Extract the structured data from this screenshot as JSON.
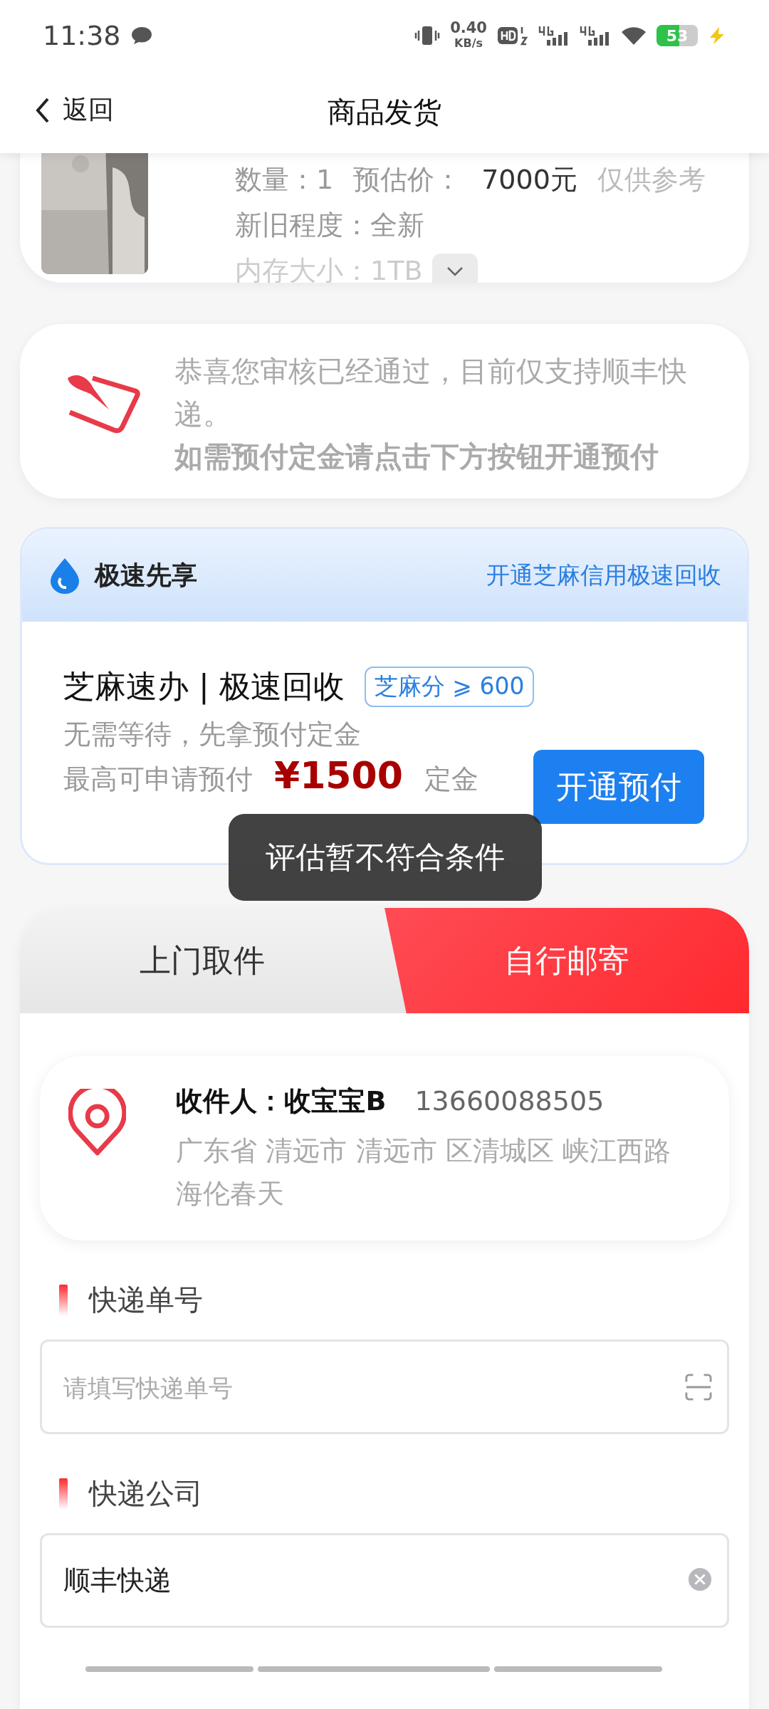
{
  "status_bar": {
    "time": "11:38",
    "speed": "0.40",
    "speed_unit": "KB/s",
    "battery": "53"
  },
  "header": {
    "back": "返回",
    "title": "商品发货"
  },
  "product": {
    "quantity": "数量：1",
    "price_label": "预估价：",
    "price": "7000元",
    "price_note": "仅供参考",
    "condition": "新旧程度：全新",
    "storage": "内存大小：1TB"
  },
  "notice": {
    "text": "恭喜您审核已经通过，目前仅支持顺丰快递。",
    "bold_text": "如需预付定金请点击下方按钮开通预付"
  },
  "prepay": {
    "title": "极速先享",
    "link": "开通芝麻信用极速回收",
    "heading": "芝麻速办 | 极速回收",
    "badge": "芝麻分 ⩾ 600",
    "subtitle": "无需等待，先拿预付定金",
    "limit_prefix": "最高可申请预付",
    "amount": "¥1500",
    "limit_suffix": "定金",
    "button": "开通预付"
  },
  "toast": "评估暂不符合条件",
  "tabs": [
    {
      "label": "上门取件",
      "selected": false
    },
    {
      "label": "自行邮寄",
      "selected": true
    }
  ],
  "address": {
    "recipient": "收件人：收宝宝B",
    "phone": "13660088505",
    "address": "广东省 清远市 清远市 区清城区 峡江西路海伦春天"
  },
  "fields": [
    {
      "label": "快递单号",
      "placeholder": "请填写快递单号",
      "kind": "scan"
    },
    {
      "label": "快递公司",
      "value": "顺丰快递",
      "kind": "clear"
    }
  ]
}
